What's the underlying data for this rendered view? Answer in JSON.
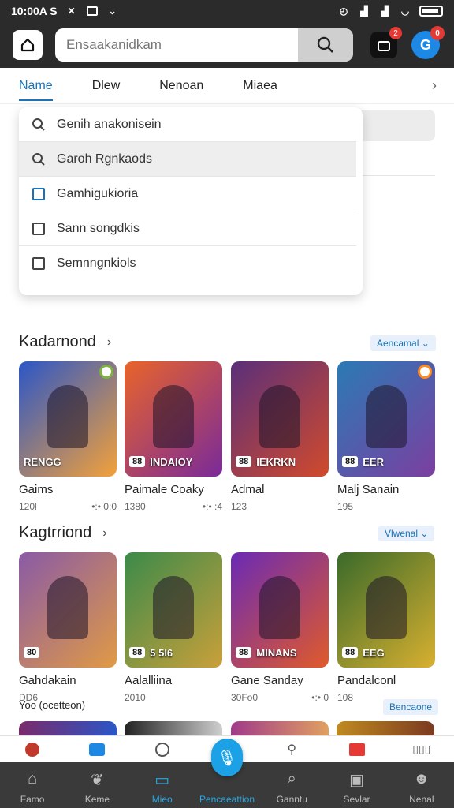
{
  "status": {
    "time": "10:00A S"
  },
  "header": {
    "search_placeholder": "Ensaakanidkam",
    "notif_count": "2",
    "profile_letter": "G",
    "profile_badge": "0"
  },
  "tabs": [
    {
      "label": "Name"
    },
    {
      "label": "Dlew"
    },
    {
      "label": "Nenoan"
    },
    {
      "label": "Miaea"
    }
  ],
  "dropdown": [
    {
      "label": "Genih anakonisein",
      "icon": "search-icon"
    },
    {
      "label": "Garoh Rgnkaods",
      "icon": "search-icon"
    },
    {
      "label": "Gamhigukioria",
      "icon": "checkbox-icon"
    },
    {
      "label": "Sann songdkis",
      "icon": "checkbox-icon"
    },
    {
      "label": "Semnngnkiols",
      "icon": "checkbox-icon"
    }
  ],
  "section1": {
    "title": "Kadarnond",
    "pill": "Aencamal",
    "cards": [
      {
        "name": "Gaims",
        "meta_l": "120l",
        "meta_r": "•:• 0:0",
        "label": "RENGG",
        "num": "",
        "bg": "#2b56c7",
        "bg2": "#f3a13a",
        "corner": "green"
      },
      {
        "name": "Paimale Coaky",
        "meta_l": "1380",
        "meta_r": "•:• :4",
        "label": "INDAIOY",
        "num": "88",
        "bg": "#e8642a",
        "bg2": "#7a2a9a",
        "corner": ""
      },
      {
        "name": "Admal",
        "meta_l": "123",
        "meta_r": "",
        "label": "IEKRKN",
        "num": "88",
        "bg": "#5a2f7a",
        "bg2": "#d14a2c",
        "corner": ""
      },
      {
        "name": "Malj Sanain",
        "meta_l": "195",
        "meta_r": "",
        "label": "EER",
        "num": "88",
        "bg": "#2b7ab5",
        "bg2": "#7b3fa0",
        "corner": "orange"
      }
    ]
  },
  "section2": {
    "title": "Kagtrriond",
    "pill": "Vlwenal",
    "cards": [
      {
        "name": "Gahdakain",
        "meta_l": "DD6",
        "meta_r": "",
        "label": "",
        "num": "80",
        "bg": "#8a5aa6",
        "bg2": "#e09a45",
        "corner": ""
      },
      {
        "name": "Aalalliina",
        "meta_l": "2010",
        "meta_r": "",
        "label": "5 5I6",
        "num": "88",
        "bg": "#3b8a4a",
        "bg2": "#c9a03a",
        "corner": ""
      },
      {
        "name": "Gane Sanday",
        "meta_l": "30Fo0",
        "meta_r": "•:• 0",
        "label": "MINANS",
        "num": "88",
        "bg": "#6a2ab5",
        "bg2": "#e05a2a",
        "corner": ""
      },
      {
        "name": "Pandalconl",
        "meta_l": "108",
        "meta_r": "",
        "label": "EEG",
        "num": "88",
        "bg": "#3a6a2a",
        "bg2": "#d8b030",
        "corner": ""
      }
    ],
    "footnote": "Yoo (ocetteon)",
    "footnote_pill": "Bencaone"
  },
  "nav": [
    {
      "label": "Famo",
      "icon": "home-icon"
    },
    {
      "label": "Keme",
      "icon": "leaf-icon"
    },
    {
      "label": "Mieo",
      "icon": "folder-icon"
    },
    {
      "label": "Pencaeattion",
      "icon": "microphone-icon"
    },
    {
      "label": "Ganntu",
      "icon": "search-icon"
    },
    {
      "label": "Sevlar",
      "icon": "chart-icon"
    },
    {
      "label": "Nenal",
      "icon": "person-icon"
    }
  ],
  "colors": {
    "accent": "#1a73b8",
    "appbar": "#2b2b2b",
    "nav_active": "#29a8e0"
  }
}
